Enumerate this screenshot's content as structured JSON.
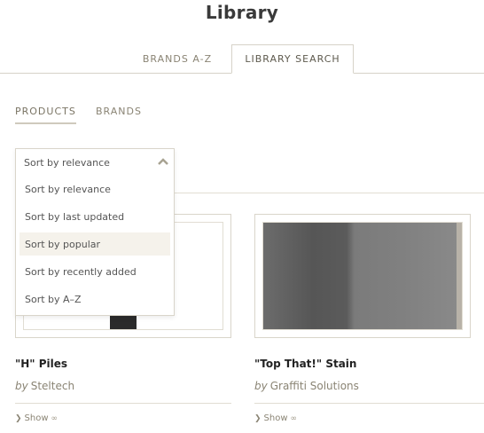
{
  "page": {
    "title": "Library"
  },
  "main_tabs": [
    {
      "label": "BRANDS A-Z"
    },
    {
      "label": "LIBRARY SEARCH"
    }
  ],
  "sub_tabs": [
    {
      "label": "PRODUCTS"
    },
    {
      "label": "BRANDS"
    }
  ],
  "sort": {
    "selected": "Sort by relevance",
    "options": [
      {
        "label": "Sort by relevance"
      },
      {
        "label": "Sort by last updated"
      },
      {
        "label": "Sort by popular"
      },
      {
        "label": "Sort by recently added"
      },
      {
        "label": "Sort by A–Z"
      }
    ]
  },
  "products": [
    {
      "title": "\"H\" Piles",
      "by": "by",
      "brand": "Steltech",
      "show": "Show"
    },
    {
      "title": "\"Top That!\" Stain",
      "by": "by",
      "brand": "Graffiti Solutions",
      "show": "Show"
    }
  ],
  "colors": {
    "accent": "#8a8474",
    "border": "#d9d5ca",
    "highlight": "#f5f2eb"
  }
}
